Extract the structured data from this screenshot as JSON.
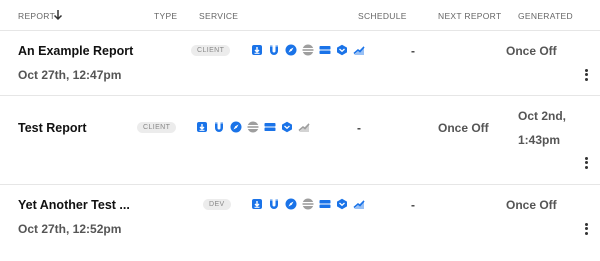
{
  "columns": {
    "report": "REPORT",
    "type": "TYPE",
    "service": "SERVICE",
    "schedule": "SCHEDULE",
    "next_report": "NEXT REPORT",
    "generated": "GENERATED"
  },
  "colors": {
    "service_active": "#1a73e8",
    "service_inactive": "#9e9e9e",
    "badge_bg": "#ececec"
  },
  "service_icons": [
    "download-icon",
    "magnet-icon",
    "compass-icon",
    "striped-circle-icon",
    "server-icon",
    "cube-icon",
    "chart-icon"
  ],
  "reports": [
    {
      "title": "An Example Report",
      "date": "Oct 27th, 12:47pm",
      "type": "CLIENT",
      "schedule": "-",
      "next_report": "",
      "generated": "Once Off",
      "services_active": [
        true,
        true,
        true,
        false,
        true,
        true,
        true
      ]
    },
    {
      "title": "Test Report",
      "date": "",
      "type": "CLIENT",
      "schedule": "-",
      "next_report": "Once Off",
      "generated_line1": "Oct 2nd,",
      "generated_line2": "1:43pm",
      "services_active": [
        true,
        true,
        true,
        false,
        true,
        true,
        false
      ]
    },
    {
      "title": "Yet Another Test ...",
      "date": "Oct 27th, 12:52pm",
      "type": "DEV",
      "schedule": "-",
      "next_report": "",
      "generated": "Once Off",
      "services_active": [
        true,
        true,
        true,
        false,
        true,
        true,
        true
      ]
    }
  ]
}
